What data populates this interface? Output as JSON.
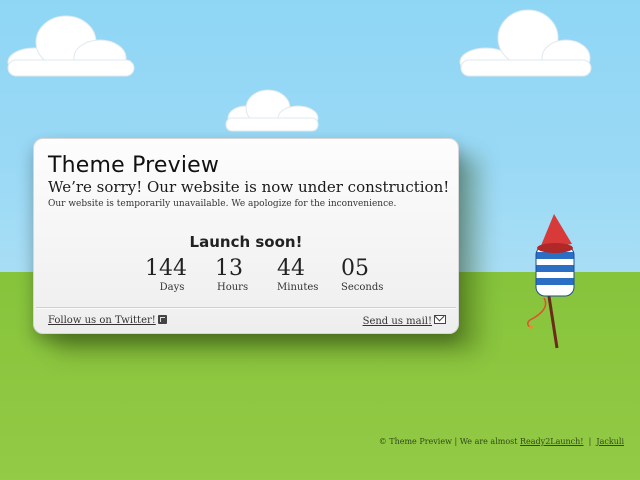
{
  "card": {
    "title": "Theme Preview",
    "subtitle": "We’re sorry! Our website is now under construction!",
    "description": "Our website is temporarily unavailable. We apologize for the inconvenience.",
    "launch_heading": "Launch soon!",
    "countdown": [
      {
        "value": "144",
        "label": "Days"
      },
      {
        "value": "13",
        "label": "Hours"
      },
      {
        "value": "44",
        "label": "Minutes"
      },
      {
        "value": "05",
        "label": "Seconds"
      }
    ],
    "twitter_link": "Follow us on Twitter!",
    "mail_link": "Send us mail!"
  },
  "footer": {
    "prefix": "© Theme Preview | We are almost",
    "ready_link": "Ready2Launch!",
    "separator": "|",
    "author_link": "Jackuli"
  },
  "colors": {
    "sky": "#8fd6f5",
    "grass": "#8cc63f",
    "rocket_red": "#d83a3a",
    "rocket_blue": "#2b6fc4"
  },
  "icons": [
    "twitter-icon",
    "mail-icon",
    "cloud-illustration",
    "rocket-illustration"
  ]
}
